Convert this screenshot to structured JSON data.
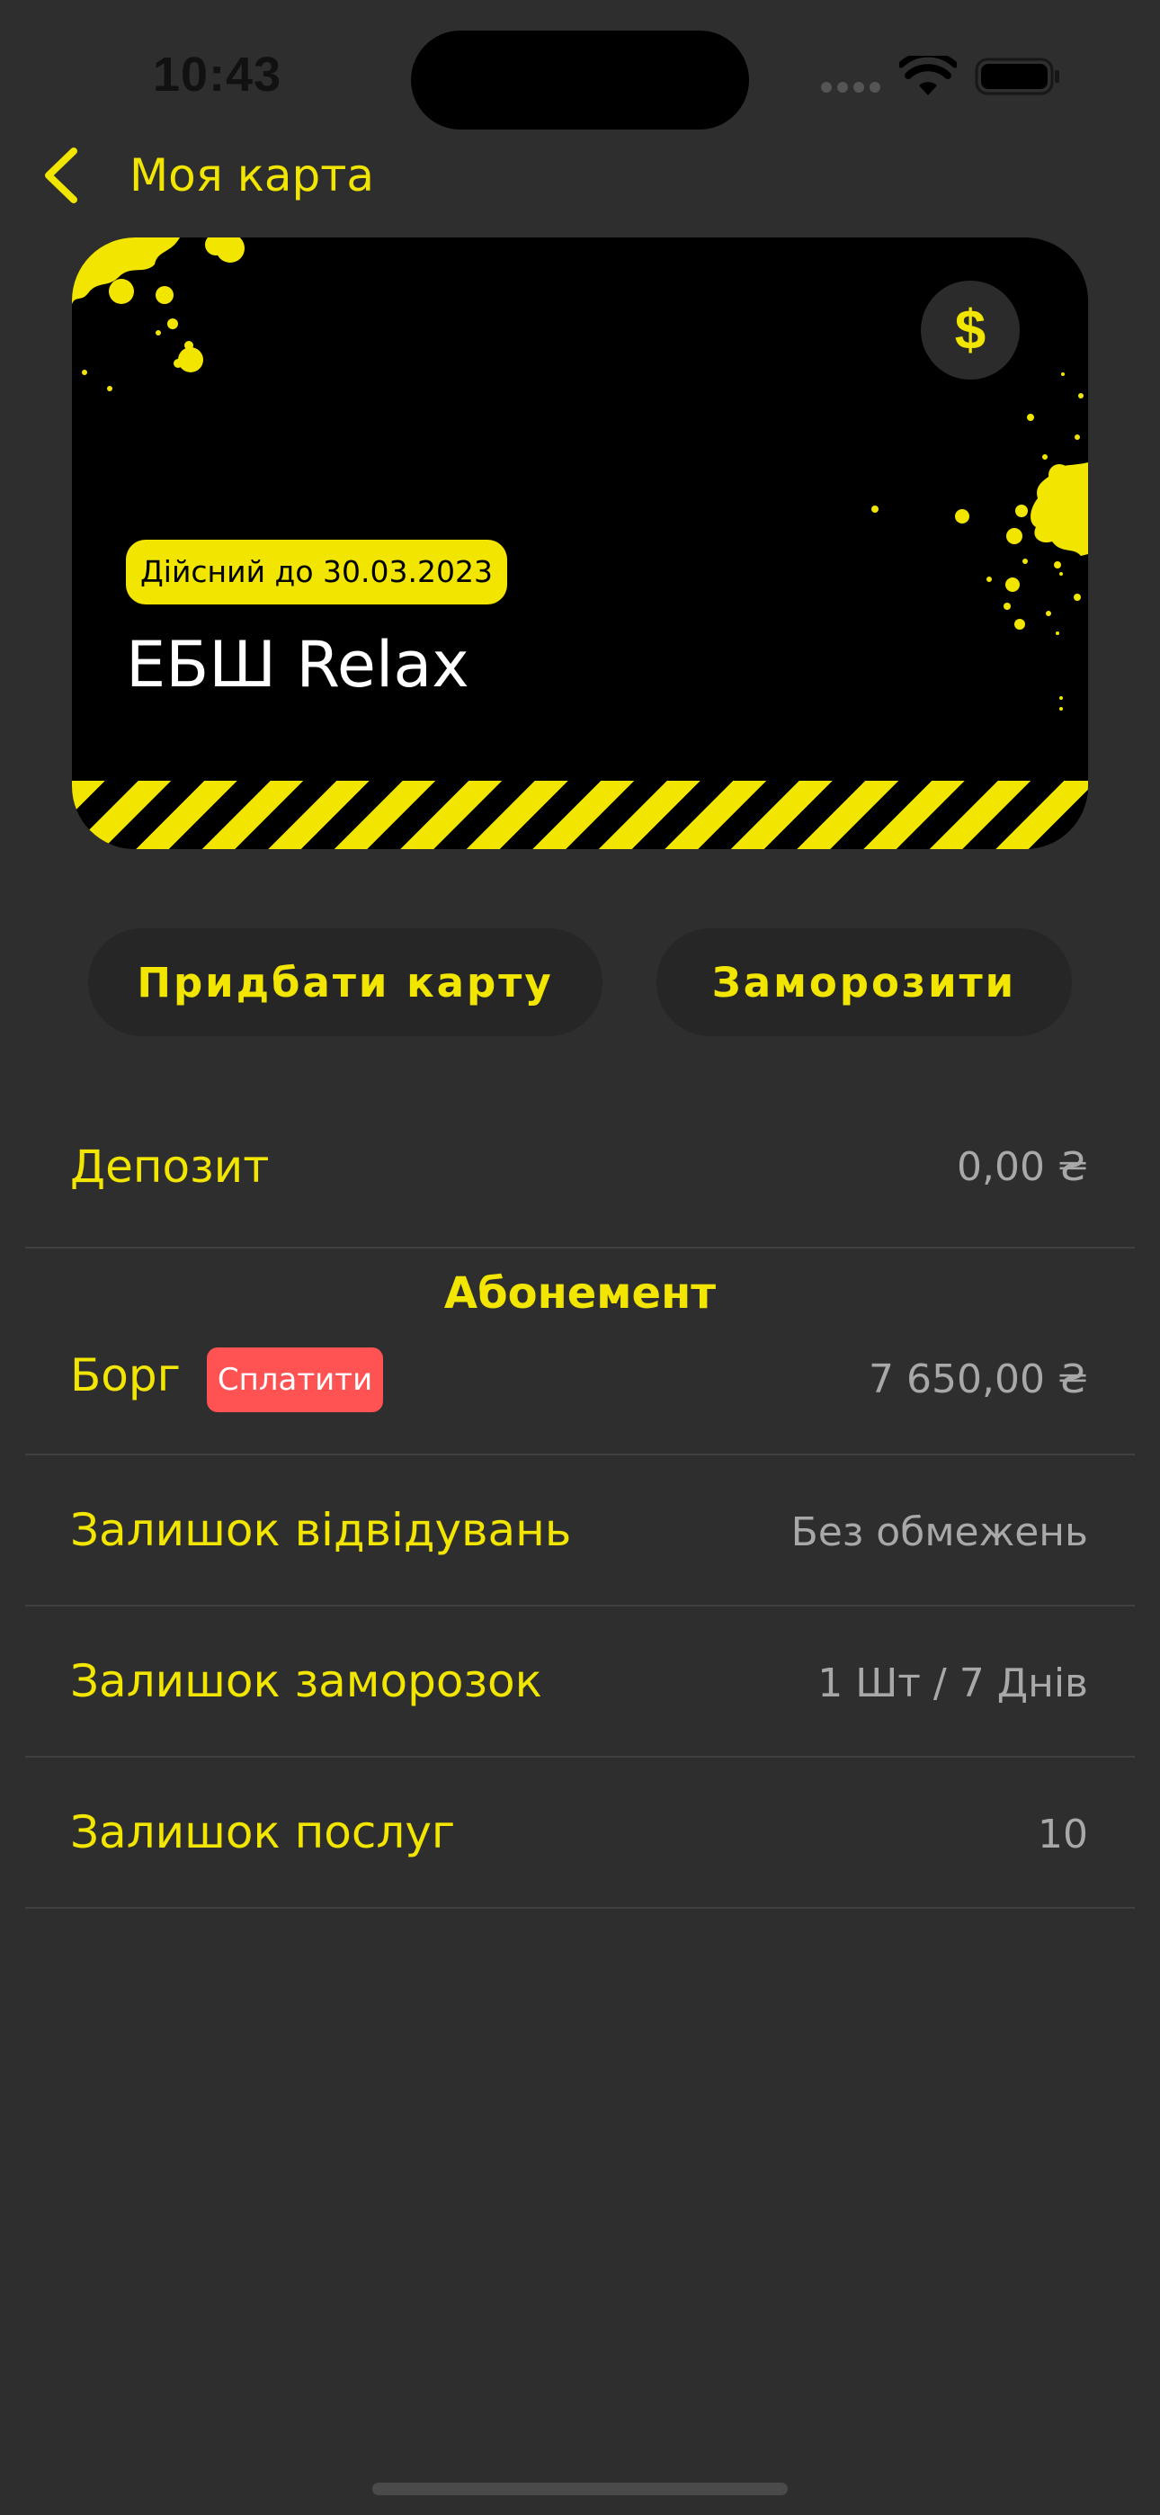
{
  "status_bar": {
    "time": "10:43"
  },
  "nav": {
    "title": "Моя карта"
  },
  "card": {
    "currency_symbol": "$",
    "valid_until": "Дійсний до 30.03.2023",
    "name": "ЕБШ Relax"
  },
  "actions": {
    "buy_label": "Придбати карту",
    "freeze_label": "Заморозити"
  },
  "deposit": {
    "label": "Депозит",
    "value": "0,00 ₴"
  },
  "subscription": {
    "title": "Абонемент",
    "debt_label": "Борг",
    "pay_label": "Сплатити",
    "debt_value": "7 650,00 ₴"
  },
  "rows": [
    {
      "label": "Залишок відвідувань",
      "value": "Без обмежень"
    },
    {
      "label": "Залишок заморозок",
      "value": "1 Шт / 7 Днів"
    },
    {
      "label": "Залишок послуг",
      "value": "10"
    }
  ],
  "colors": {
    "accent": "#f2e600",
    "background": "#2e2e2e",
    "danger": "#ff5252"
  }
}
